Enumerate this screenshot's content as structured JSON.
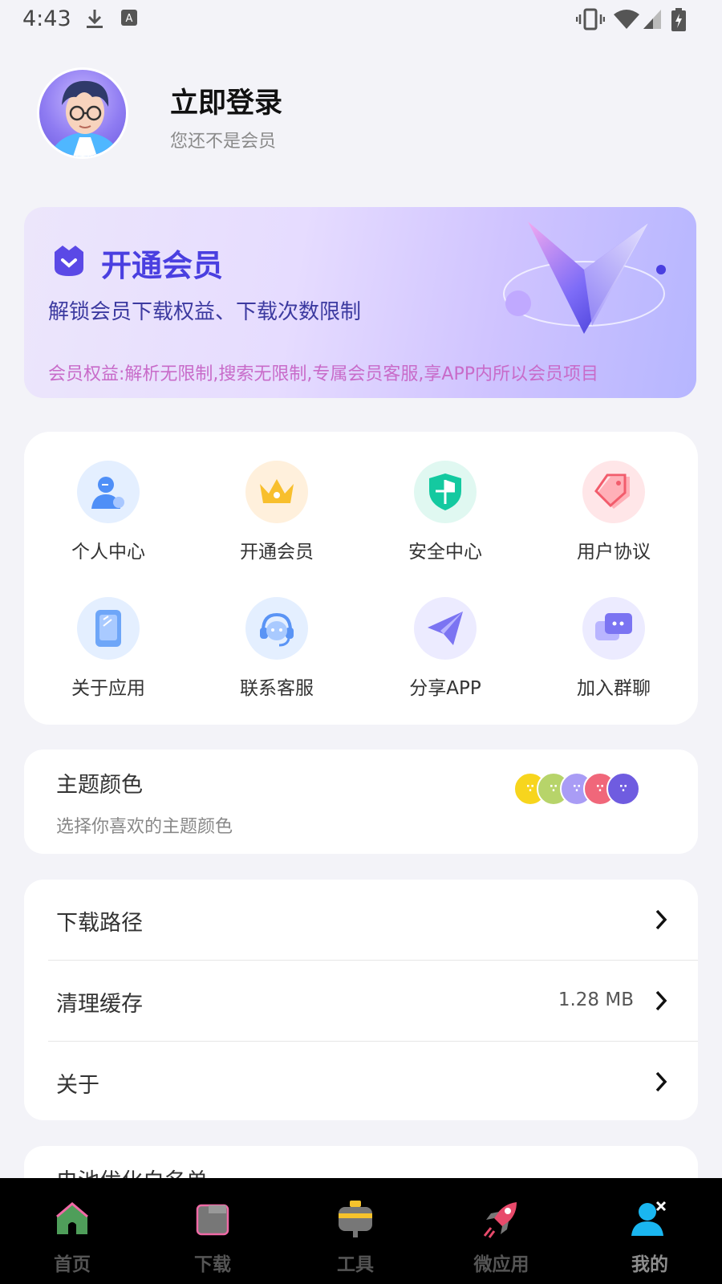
{
  "status_bar": {
    "time": "4:43",
    "icons": [
      "download-icon",
      "keyboard-a-icon",
      "vibrate-icon",
      "wifi-icon",
      "signal-icon",
      "battery-icon"
    ]
  },
  "profile": {
    "login_label": "立即登录",
    "member_status": "您还不是会员"
  },
  "vip_card": {
    "title": "开通会员",
    "description": "解锁会员下载权益、下载次数限制",
    "benefits": "会员权益:解析无限制,搜索无限制,专属会员客服,享APP内所以会员项目",
    "accent_color": "#4a3fe0"
  },
  "menu_grid": {
    "items": [
      {
        "label": "个人中心",
        "icon": "person-icon",
        "color": "#e4efff"
      },
      {
        "label": "开通会员",
        "icon": "crown-icon",
        "color": "#fff0dc"
      },
      {
        "label": "安全中心",
        "icon": "shield-icon",
        "color": "#e0f8f1"
      },
      {
        "label": "用户协议",
        "icon": "tag-icon",
        "color": "#ffe6e8"
      },
      {
        "label": "关于应用",
        "icon": "phone-icon",
        "color": "#e4efff"
      },
      {
        "label": "联系客服",
        "icon": "headset-icon",
        "color": "#e4efff"
      },
      {
        "label": "分享APP",
        "icon": "send-icon",
        "color": "#ecebff"
      },
      {
        "label": "加入群聊",
        "icon": "chat-icon",
        "color": "#ecebff"
      }
    ]
  },
  "theme": {
    "title": "主题颜色",
    "subtitle": "选择你喜欢的主题颜色",
    "colors": [
      "#f7d51d",
      "#b7d46a",
      "#a99cf5",
      "#f0677a",
      "#6f5ce0"
    ]
  },
  "settings": {
    "rows": [
      {
        "label": "下载路径",
        "value": ""
      },
      {
        "label": "清理缓存",
        "value": "1.28 MB"
      },
      {
        "label": "关于",
        "value": ""
      }
    ],
    "partial_row": "电池优化白名单"
  },
  "bottom_nav": {
    "items": [
      {
        "label": "首页",
        "icon": "home-icon"
      },
      {
        "label": "下载",
        "icon": "folder-icon"
      },
      {
        "label": "工具",
        "icon": "toolbox-icon"
      },
      {
        "label": "微应用",
        "icon": "rocket-icon"
      },
      {
        "label": "我的",
        "icon": "user-icon"
      }
    ],
    "active_index": 4
  }
}
